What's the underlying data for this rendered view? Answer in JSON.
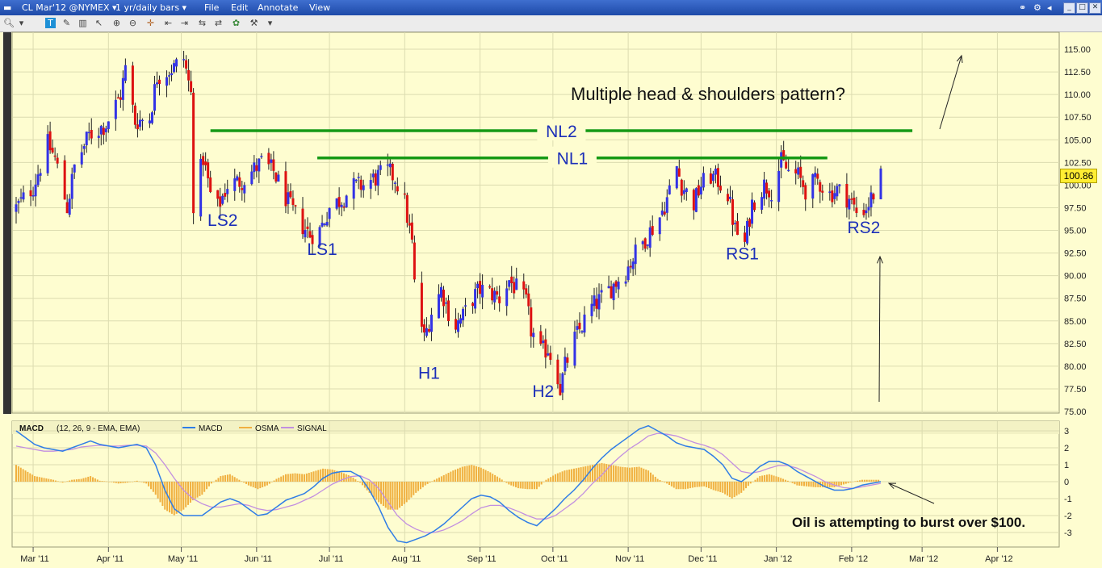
{
  "window": {
    "symbol": "CL Mar'12 @NYMEX",
    "period": "1 yr/daily bars",
    "menu": [
      "File",
      "Edit",
      "Annotate",
      "View"
    ]
  },
  "colors": {
    "background": "#fefdd0",
    "up_bar": "#3232e6",
    "down_bar": "#dd1111",
    "neckline": "#159915",
    "label": "#1c2fb8",
    "macd": "#2f7de6",
    "osma": "#f0b040",
    "signal": "#c28fe0",
    "price_tag": "#ffee33"
  },
  "chart_data": [
    {
      "type": "candlestick",
      "x_ticks": [
        "Mar '11",
        "Apr '11",
        "May '11",
        "Jun '11",
        "Jul '11",
        "Aug '11",
        "Sep '11",
        "Oct '11",
        "Nov '11",
        "Dec '11",
        "Jan '12",
        "Feb '12",
        "Mar '12",
        "Apr '12"
      ],
      "y_ticks": [
        "115.00",
        "112.50",
        "110.00",
        "107.50",
        "105.00",
        "102.50",
        "100.00",
        "97.50",
        "95.00",
        "92.50",
        "90.00",
        "87.50",
        "85.00",
        "82.50",
        "80.00",
        "77.50",
        "75.00"
      ],
      "ylim": [
        75,
        115
      ],
      "last_price": "100.86",
      "closes": [
        {
          "date": "2011-02-22",
          "close": 97.5
        },
        {
          "date": "2011-03-01",
          "close": 99.8
        },
        {
          "date": "2011-03-07",
          "close": 104.5
        },
        {
          "date": "2011-03-10",
          "close": 103.0
        },
        {
          "date": "2011-03-15",
          "close": 97.5
        },
        {
          "date": "2011-03-18",
          "close": 102.0
        },
        {
          "date": "2011-03-24",
          "close": 105.5
        },
        {
          "date": "2011-03-31",
          "close": 106.7
        },
        {
          "date": "2011-04-06",
          "close": 110.0
        },
        {
          "date": "2011-04-08",
          "close": 112.8
        },
        {
          "date": "2011-04-12",
          "close": 107.0
        },
        {
          "date": "2011-04-18",
          "close": 107.5
        },
        {
          "date": "2011-04-21",
          "close": 112.0
        },
        {
          "date": "2011-04-28",
          "close": 113.0
        },
        {
          "date": "2011-05-02",
          "close": 114.0
        },
        {
          "date": "2011-05-05",
          "close": 110.0
        },
        {
          "date": "2011-05-06",
          "close": 98.0
        },
        {
          "date": "2011-05-10",
          "close": 103.0
        },
        {
          "date": "2011-05-13",
          "close": 99.0
        },
        {
          "date": "2011-05-16",
          "close": 97.5
        },
        {
          "date": "2011-05-20",
          "close": 100.0
        },
        {
          "date": "2011-05-26",
          "close": 100.5
        },
        {
          "date": "2011-06-01",
          "close": 102.0
        },
        {
          "date": "2011-06-03",
          "close": 102.5
        },
        {
          "date": "2011-06-08",
          "close": 101.5
        },
        {
          "date": "2011-06-10",
          "close": 100.3
        },
        {
          "date": "2011-06-15",
          "close": 97.5
        },
        {
          "date": "2011-06-20",
          "close": 95.5
        },
        {
          "date": "2011-06-23",
          "close": 94.5
        },
        {
          "date": "2011-06-27",
          "close": 95.0
        },
        {
          "date": "2011-07-01",
          "close": 97.5
        },
        {
          "date": "2011-07-06",
          "close": 98.5
        },
        {
          "date": "2011-07-11",
          "close": 99.8
        },
        {
          "date": "2011-07-15",
          "close": 100.0
        },
        {
          "date": "2011-07-20",
          "close": 100.8
        },
        {
          "date": "2011-07-25",
          "close": 101.5
        },
        {
          "date": "2011-07-28",
          "close": 100.8
        },
        {
          "date": "2011-08-01",
          "close": 98.0
        },
        {
          "date": "2011-08-04",
          "close": 93.5
        },
        {
          "date": "2011-08-05",
          "close": 89.0
        },
        {
          "date": "2011-08-08",
          "close": 84.5
        },
        {
          "date": "2011-08-09",
          "close": 83.0
        },
        {
          "date": "2011-08-12",
          "close": 86.0
        },
        {
          "date": "2011-08-16",
          "close": 88.5
        },
        {
          "date": "2011-08-19",
          "close": 86.0
        },
        {
          "date": "2011-08-22",
          "close": 84.5
        },
        {
          "date": "2011-08-25",
          "close": 85.5
        },
        {
          "date": "2011-08-29",
          "close": 87.5
        },
        {
          "date": "2011-09-01",
          "close": 88.5
        },
        {
          "date": "2011-09-06",
          "close": 88.0
        },
        {
          "date": "2011-09-09",
          "close": 87.5
        },
        {
          "date": "2011-09-13",
          "close": 89.5
        },
        {
          "date": "2011-09-16",
          "close": 88.5
        },
        {
          "date": "2011-09-20",
          "close": 87.0
        },
        {
          "date": "2011-09-22",
          "close": 84.0
        },
        {
          "date": "2011-09-26",
          "close": 81.5
        },
        {
          "date": "2011-09-29",
          "close": 82.0
        },
        {
          "date": "2011-10-03",
          "close": 79.0
        },
        {
          "date": "2011-10-04",
          "close": 77.5
        },
        {
          "date": "2011-10-06",
          "close": 80.0
        },
        {
          "date": "2011-10-10",
          "close": 83.0
        },
        {
          "date": "2011-10-13",
          "close": 84.5
        },
        {
          "date": "2011-10-17",
          "close": 86.5
        },
        {
          "date": "2011-10-21",
          "close": 87.5
        },
        {
          "date": "2011-10-26",
          "close": 89.0
        },
        {
          "date": "2011-10-31",
          "close": 90.5
        },
        {
          "date": "2011-11-04",
          "close": 92.5
        },
        {
          "date": "2011-11-09",
          "close": 94.5
        },
        {
          "date": "2011-11-14",
          "close": 96.5
        },
        {
          "date": "2011-11-17",
          "close": 98.5
        },
        {
          "date": "2011-11-21",
          "close": 102.0
        },
        {
          "date": "2011-11-23",
          "close": 100.0
        },
        {
          "date": "2011-11-28",
          "close": 98.0
        },
        {
          "date": "2011-12-01",
          "close": 100.0
        },
        {
          "date": "2011-12-05",
          "close": 101.0
        },
        {
          "date": "2011-12-08",
          "close": 100.5
        },
        {
          "date": "2011-12-12",
          "close": 99.0
        },
        {
          "date": "2011-12-15",
          "close": 95.0
        },
        {
          "date": "2011-12-19",
          "close": 93.5
        },
        {
          "date": "2011-12-22",
          "close": 98.0
        },
        {
          "date": "2011-12-27",
          "close": 100.0
        },
        {
          "date": "2011-12-30",
          "close": 99.5
        },
        {
          "date": "2012-01-03",
          "close": 102.5
        },
        {
          "date": "2012-01-06",
          "close": 101.5
        },
        {
          "date": "2012-01-10",
          "close": 101.0
        },
        {
          "date": "2012-01-13",
          "close": 99.5
        },
        {
          "date": "2012-01-18",
          "close": 100.5
        },
        {
          "date": "2012-01-23",
          "close": 99.0
        },
        {
          "date": "2012-01-26",
          "close": 99.5
        },
        {
          "date": "2012-01-31",
          "close": 98.5
        },
        {
          "date": "2012-02-03",
          "close": 97.0
        },
        {
          "date": "2012-02-07",
          "close": 97.5
        },
        {
          "date": "2012-02-10",
          "close": 99.0
        },
        {
          "date": "2012-02-13",
          "close": 100.86
        }
      ],
      "necklines": [
        {
          "label": "NL1",
          "y": 103.0,
          "from": "2011-06-26",
          "to": "2012-01-22"
        },
        {
          "label": "NL2",
          "y": 106.0,
          "from": "2011-05-13",
          "to": "2012-02-26"
        }
      ],
      "pattern_labels": [
        {
          "text": "LS2",
          "date": "2011-05-18",
          "price": 95.5
        },
        {
          "text": "LS1",
          "date": "2011-06-28",
          "price": 92.3
        },
        {
          "text": "H1",
          "date": "2011-08-11",
          "price": 78.6
        },
        {
          "text": "H2",
          "date": "2011-09-27",
          "price": 76.6
        },
        {
          "text": "RS1",
          "date": "2011-12-18",
          "price": 91.8
        },
        {
          "text": "RS2",
          "date": "2012-02-06",
          "price": 94.7
        }
      ],
      "annotations": {
        "title_text": "Multiple head & shoulders pattern?",
        "bottom_text": "Oil is attempting to burst over $100."
      }
    },
    {
      "type": "line",
      "indicator": "MACD",
      "params": "(12, 26, 9 - EMA, EMA)",
      "legend": [
        "MACD",
        "OSMA",
        "SIGNAL"
      ],
      "y_ticks": [
        "3",
        "2",
        "1",
        "0",
        "-1",
        "-2",
        "-3"
      ],
      "ylim": [
        -3.6,
        3.3
      ],
      "series": [
        {
          "name": "MACD",
          "values": [
            3.0,
            2.6,
            2.2,
            2.0,
            1.9,
            1.8,
            2.0,
            2.2,
            2.4,
            2.2,
            2.1,
            2.0,
            2.1,
            2.2,
            2.0,
            1.0,
            -0.5,
            -1.6,
            -2.0,
            -2.0,
            -2.0,
            -1.6,
            -1.2,
            -1.0,
            -1.2,
            -1.6,
            -2.0,
            -1.9,
            -1.5,
            -1.1,
            -0.9,
            -0.7,
            -0.3,
            0.2,
            0.5,
            0.6,
            0.6,
            0.3,
            -0.5,
            -1.5,
            -2.7,
            -3.5,
            -3.6,
            -3.4,
            -3.2,
            -2.9,
            -2.5,
            -2.0,
            -1.5,
            -1.0,
            -0.8,
            -0.9,
            -1.2,
            -1.7,
            -2.1,
            -2.4,
            -2.6,
            -2.1,
            -1.6,
            -1.0,
            -0.5,
            0.1,
            0.8,
            1.4,
            1.9,
            2.3,
            2.7,
            3.1,
            3.3,
            3.0,
            2.7,
            2.3,
            2.1,
            2.0,
            1.9,
            1.5,
            1.0,
            0.2,
            0.0,
            0.4,
            0.9,
            1.2,
            1.2,
            1.0,
            0.6,
            0.3,
            0.0,
            -0.3,
            -0.5,
            -0.5,
            -0.4,
            -0.2,
            -0.1,
            0.0
          ]
        },
        {
          "name": "SIGNAL",
          "values": [
            2.1,
            2.0,
            1.9,
            1.8,
            1.8,
            1.85,
            1.9,
            2.05,
            2.1,
            2.15,
            2.1,
            2.1,
            2.15,
            2.15,
            2.1,
            1.7,
            1.0,
            0.2,
            -0.5,
            -1.0,
            -1.3,
            -1.5,
            -1.5,
            -1.4,
            -1.3,
            -1.4,
            -1.6,
            -1.7,
            -1.65,
            -1.5,
            -1.35,
            -1.1,
            -0.85,
            -0.5,
            -0.15,
            0.1,
            0.3,
            0.35,
            0.1,
            -0.4,
            -1.2,
            -2.0,
            -2.5,
            -2.8,
            -3.0,
            -3.0,
            -2.85,
            -2.6,
            -2.3,
            -1.9,
            -1.55,
            -1.4,
            -1.4,
            -1.55,
            -1.75,
            -2.0,
            -2.2,
            -2.2,
            -2.0,
            -1.6,
            -1.2,
            -0.7,
            -0.1,
            0.4,
            1.0,
            1.5,
            1.95,
            2.3,
            2.7,
            2.85,
            2.8,
            2.7,
            2.5,
            2.3,
            2.15,
            1.95,
            1.6,
            1.1,
            0.6,
            0.5,
            0.6,
            0.8,
            0.95,
            0.95,
            0.8,
            0.55,
            0.3,
            0.0,
            -0.2,
            -0.35,
            -0.4,
            -0.3,
            -0.2,
            -0.1
          ]
        }
      ]
    }
  ]
}
